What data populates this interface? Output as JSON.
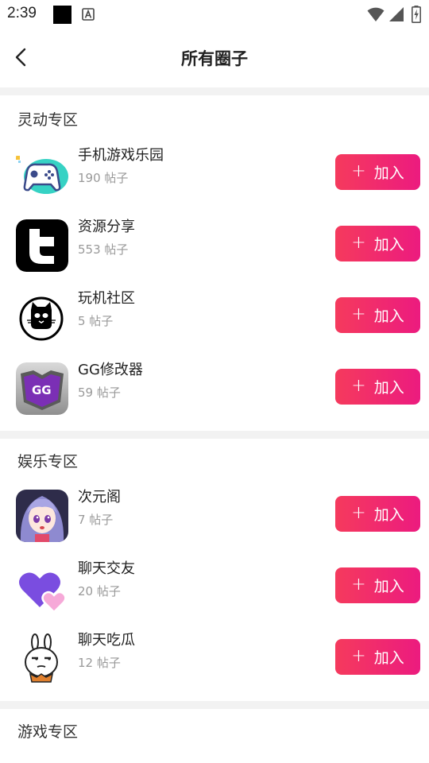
{
  "status_bar": {
    "time": "2:39"
  },
  "header": {
    "title": "所有圈子"
  },
  "join_plus": "+",
  "sections": [
    {
      "title": "灵动专区",
      "items": [
        {
          "name": "手机游戏乐园",
          "count": "190 帖子",
          "join_label": "加入",
          "icon": "gamepad-icon"
        },
        {
          "name": "资源分享",
          "count": "553 帖子",
          "join_label": "加入",
          "icon": "t-logo-icon"
        },
        {
          "name": "玩机社区",
          "count": "5 帖子",
          "join_label": "加入",
          "icon": "cat-icon"
        },
        {
          "name": "GG修改器",
          "count": "59 帖子",
          "join_label": "加入",
          "icon": "gg-logo-icon"
        }
      ]
    },
    {
      "title": "娱乐专区",
      "items": [
        {
          "name": "次元阁",
          "count": "7 帖子",
          "join_label": "加入",
          "icon": "anime-girl-icon"
        },
        {
          "name": "聊天交友",
          "count": "20 帖子",
          "join_label": "加入",
          "icon": "hearts-icon"
        },
        {
          "name": "聊天吃瓜",
          "count": "12 帖子",
          "join_label": "加入",
          "icon": "rabbit-icon"
        }
      ]
    },
    {
      "title": "游戏专区",
      "items": []
    }
  ],
  "colors": {
    "join_start": "#f53a5d",
    "join_end": "#ec1b7f",
    "divider": "#f2f2f2"
  }
}
